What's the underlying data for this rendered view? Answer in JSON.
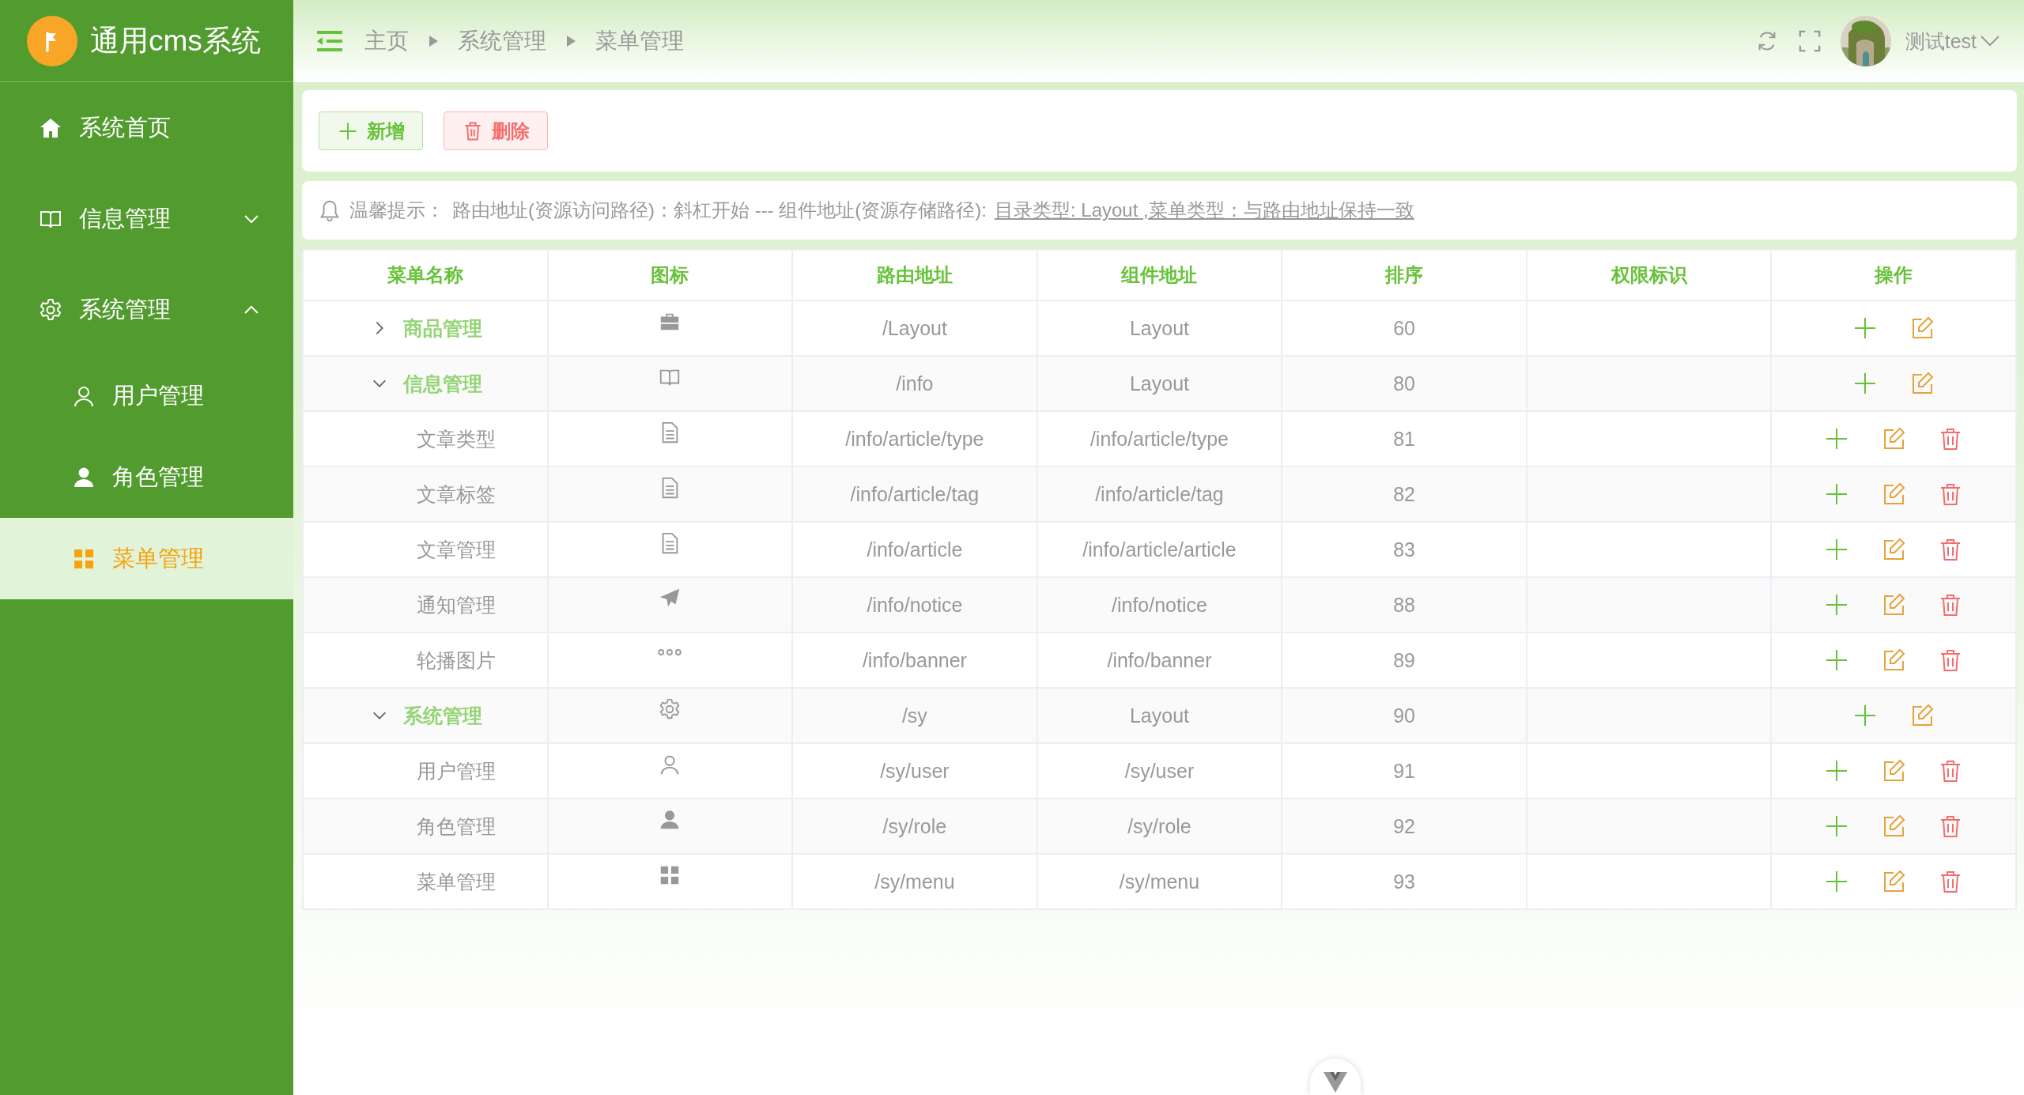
{
  "app": {
    "title": "通用cms系统"
  },
  "sidebar": {
    "items": [
      {
        "kind": "home",
        "label": "系统首页",
        "selected": false
      },
      {
        "kind": "book",
        "label": "信息管理",
        "expanded": false
      },
      {
        "kind": "gear",
        "label": "系统管理",
        "expanded": true,
        "children": [
          {
            "kind": "user",
            "label": "用户管理",
            "selected": false
          },
          {
            "kind": "user-filled",
            "label": "角色管理",
            "selected": false
          },
          {
            "kind": "grid",
            "label": "菜单管理",
            "selected": true
          }
        ]
      }
    ]
  },
  "header": {
    "breadcrumbs": [
      "主页",
      "系统管理",
      "菜单管理"
    ],
    "user": {
      "name": "测试test"
    }
  },
  "toolbar": {
    "buttons": [
      {
        "kind": "add",
        "label": "新增"
      },
      {
        "kind": "delete",
        "label": "删除"
      }
    ]
  },
  "hint": {
    "label": "温馨提示：",
    "text": "路由地址(资源访问路径)：斜杠开始 --- 组件地址(资源存储路径):",
    "note": "目录类型: Layout ,菜单类型：与路由地址保持一致"
  },
  "table": {
    "columns": [
      "菜单名称",
      "图标",
      "路由地址",
      "组件地址",
      "排序",
      "权限标识",
      "操作"
    ],
    "rows": [
      {
        "kind": "briefcase",
        "name": "商品管理",
        "path": "/Layout",
        "component": "Layout",
        "sort": "60",
        "deletable": false,
        "expanded": false
      },
      {
        "kind": "book",
        "name": "信息管理",
        "path": "/info",
        "component": "Layout",
        "sort": "80",
        "deletable": false,
        "expanded": true,
        "children": [
          {
            "kind": "document",
            "name": "文章类型",
            "path": "/info/article/type",
            "component": "/info/article/type",
            "sort": "81",
            "deletable": true
          },
          {
            "kind": "document",
            "name": "文章标签",
            "path": "/info/article/tag",
            "component": "/info/article/tag",
            "sort": "82",
            "deletable": true
          },
          {
            "kind": "document",
            "name": "文章管理",
            "path": "/info/article",
            "component": "/info/article/article",
            "sort": "83",
            "deletable": true
          },
          {
            "kind": "plane",
            "name": "通知管理",
            "path": "/info/notice",
            "component": "/info/notice",
            "sort": "88",
            "deletable": true
          },
          {
            "kind": "dots",
            "name": "轮播图片",
            "path": "/info/banner",
            "component": "/info/banner",
            "sort": "89",
            "deletable": true
          }
        ]
      },
      {
        "kind": "gear",
        "name": "系统管理",
        "path": "/sy",
        "component": "Layout",
        "sort": "90",
        "deletable": false,
        "expanded": true,
        "children": [
          {
            "kind": "user",
            "name": "用户管理",
            "path": "/sy/user",
            "component": "/sy/user",
            "sort": "91",
            "deletable": true
          },
          {
            "kind": "user-filled",
            "name": "角色管理",
            "path": "/sy/role",
            "component": "/sy/role",
            "sort": "92",
            "deletable": true
          },
          {
            "kind": "grid",
            "name": "菜单管理",
            "path": "/sy/menu",
            "component": "/sy/menu",
            "sort": "93",
            "deletable": true
          }
        ]
      }
    ]
  }
}
